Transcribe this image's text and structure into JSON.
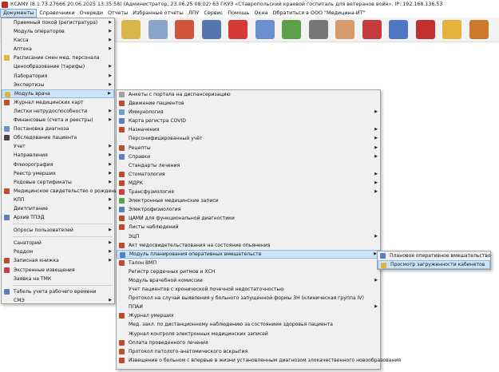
{
  "window": {
    "title": "КСАМУ (8.1.73.27666 20.06.2025 13:35:58) (Администратор, 23.06.25 08:02)  63 ГКУЗ «Ставропольский краевой госпиталь для ветеранов войн». IP: 192.168.136.53"
  },
  "menubar": [
    {
      "label": "Документы"
    },
    {
      "label": "Справочники"
    },
    {
      "label": "Очереди"
    },
    {
      "label": "Отчеты"
    },
    {
      "label": "Избранные отчеты"
    },
    {
      "label": "ЛПУ"
    },
    {
      "label": "Сервис"
    },
    {
      "label": "Помощь"
    },
    {
      "label": "Окна"
    },
    {
      "label": "Обратиться в ООО \"Медицина-ИТ\""
    }
  ],
  "toolbar": [
    {
      "icon": "notepad-icon",
      "color": "#d9b64a"
    },
    {
      "icon": "syringe-icon",
      "color": "#8aa3c9"
    },
    {
      "icon": "pill-bottle-icon",
      "color": "#d1543c"
    },
    {
      "icon": "monitor-chart-icon",
      "color": "#5577b0"
    },
    {
      "icon": "first-aid-icon",
      "color": "#d83a3a"
    },
    {
      "icon": "books-icon",
      "color": "#6b8fcf"
    },
    {
      "icon": "molecules-icon",
      "color": "#5aa14a"
    },
    {
      "icon": "barcode-scanner-icon",
      "color": "#777777"
    },
    {
      "icon": "doctor-icon",
      "color": "#d89b6a"
    },
    {
      "icon": "thermometer-icon",
      "color": "#c23c3c"
    },
    {
      "icon": "patients-icon",
      "color": "#4f77c4"
    },
    {
      "icon": "pdf-icon",
      "color": "#c33030"
    },
    {
      "icon": "lock-icon",
      "color": "#e3b23c"
    },
    {
      "icon": "exit-icon",
      "color": "#cc7a2a"
    }
  ],
  "menu1": [
    {
      "label": "Приемный покой (регистратура)",
      "arrow": true,
      "icon": ""
    },
    {
      "label": "Модуль операторов",
      "arrow": true,
      "icon": ""
    },
    {
      "label": "Касса",
      "arrow": true,
      "icon": ""
    },
    {
      "label": "Аптека",
      "arrow": true,
      "icon": ""
    },
    {
      "label": "Расписание смен мед. персонала",
      "arrow": false,
      "icon": "#e4b53e"
    },
    {
      "label": "Ценообразование (тарифы)",
      "arrow": true,
      "icon": ""
    },
    {
      "label": "Лаборатория",
      "arrow": true,
      "icon": ""
    },
    {
      "label": "Экспертизы",
      "arrow": true,
      "icon": ""
    },
    {
      "label": "Модуль врача",
      "arrow": true,
      "icon": "#d9b64a",
      "highlight": true
    },
    {
      "label": "Журнал медицинских карт",
      "arrow": false,
      "icon": "#c04a2a"
    },
    {
      "label": "Листки нетрудоспособности",
      "arrow": true,
      "icon": ""
    },
    {
      "label": "Финансовые (счета и реестры)",
      "arrow": true,
      "icon": ""
    },
    {
      "label": "Постановка диагноза",
      "arrow": false,
      "icon": "#6c8fc9"
    },
    {
      "label": "Обследование пациента",
      "arrow": false,
      "icon": "#444444"
    },
    {
      "label": "Учет",
      "arrow": true,
      "icon": ""
    },
    {
      "label": "Направления",
      "arrow": true,
      "icon": ""
    },
    {
      "label": "Флюорография",
      "arrow": true,
      "icon": ""
    },
    {
      "label": "Реестр умерших",
      "arrow": true,
      "icon": ""
    },
    {
      "label": "Родовые сертификаты",
      "arrow": true,
      "icon": ""
    },
    {
      "label": "Медицинское свидетельство о рождении",
      "arrow": false,
      "icon": "#c04a2a"
    },
    {
      "label": "КПП",
      "arrow": true,
      "icon": ""
    },
    {
      "label": "Диетпитание",
      "arrow": true,
      "icon": ""
    },
    {
      "label": "Архив ТПЭД",
      "arrow": false,
      "icon": "#5a7fc0"
    },
    {
      "label": "Опросы пользователей",
      "arrow": true,
      "icon": "",
      "sep": true
    },
    {
      "label": "Санаторий",
      "arrow": true,
      "icon": "",
      "sep": true
    },
    {
      "label": "Роддом",
      "arrow": true,
      "icon": ""
    },
    {
      "label": "Записная книжка",
      "arrow": true,
      "icon": "#c04a2a"
    },
    {
      "label": "Экстренные извещения",
      "arrow": false,
      "icon": "#d43a3a"
    },
    {
      "label": "Заявка на ТМК",
      "arrow": false,
      "icon": ""
    },
    {
      "label": "Табель учета рабочего времени",
      "arrow": false,
      "icon": "#5a7fc0",
      "sep": true
    },
    {
      "label": "СМЭ",
      "arrow": true,
      "icon": ""
    }
  ],
  "menu2": [
    {
      "label": "Анкеты с портала на диспансеризацию",
      "arrow": false,
      "icon": "#a0a0a0"
    },
    {
      "label": "Движение пациентов",
      "arrow": false,
      "icon": "#c04a2a"
    },
    {
      "label": "Иммунология",
      "arrow": true,
      "icon": "#6aa0d0"
    },
    {
      "label": "Карта регистра COVID",
      "arrow": false,
      "icon": "#5a7fc0"
    },
    {
      "label": "Назначения",
      "arrow": true,
      "icon": "#c04a2a"
    },
    {
      "label": "Персонифицированный учёт",
      "arrow": true,
      "icon": ""
    },
    {
      "label": "Рецепты",
      "arrow": true,
      "icon": "#c04a2a"
    },
    {
      "label": "Справки",
      "arrow": true,
      "icon": "#5a7fc0"
    },
    {
      "label": "Стандарты лечения",
      "arrow": false,
      "icon": ""
    },
    {
      "label": "Стоматология",
      "arrow": true,
      "icon": "#c04a2a"
    },
    {
      "label": "МДРК",
      "arrow": true,
      "icon": "#c04a2a"
    },
    {
      "label": "Трансфузиология",
      "arrow": true,
      "icon": "#d43a3a"
    },
    {
      "label": "Электронные медицинские записи",
      "arrow": false,
      "icon": "#5aa14a"
    },
    {
      "label": "Электрофизиология",
      "arrow": false,
      "icon": "#5a7fc0"
    },
    {
      "label": "ЦАМИ для функциональной диагностики",
      "arrow": false,
      "icon": "#c04a2a"
    },
    {
      "label": "Листы наблюдений",
      "arrow": false,
      "icon": "#c04a2a"
    },
    {
      "label": "ЭЦП",
      "arrow": true,
      "icon": ""
    },
    {
      "label": "Акт медосвидетельствования на состояние опьянения",
      "arrow": false,
      "icon": "#c04a2a"
    },
    {
      "label": "Модуль планирования оперативных вмешательств",
      "arrow": true,
      "icon": "#5a7fc0",
      "highlight": true
    },
    {
      "label": "Талон ВМП",
      "arrow": false,
      "icon": "#c04a2a"
    },
    {
      "label": "Регистр сердечных ритмов и ХСН",
      "arrow": false,
      "icon": ""
    },
    {
      "label": "Модуль врачебной комиссии",
      "arrow": true,
      "icon": ""
    },
    {
      "label": "Учет пациентов с хронической почечной недостаточностью",
      "arrow": false,
      "icon": ""
    },
    {
      "label": "Протокол на случай выявления у больного запущенной формы ЗН (клиническая группа IV)",
      "arrow": false,
      "icon": ""
    },
    {
      "label": "ППАИ",
      "arrow": true,
      "icon": ""
    },
    {
      "label": "Журнал умерших",
      "arrow": false,
      "icon": "#c04a2a"
    },
    {
      "label": "Мед. закл. по дистанционному наблюдению за состоянием здоровья пациента",
      "arrow": false,
      "icon": ""
    },
    {
      "label": "Журнал контроля электронных медицинских записей",
      "arrow": false,
      "icon": ""
    },
    {
      "label": "Оплата проведенного лечения",
      "arrow": false,
      "icon": "#c04a2a"
    },
    {
      "label": "Протокол патолого-анатомического вскрытия",
      "arrow": false,
      "icon": "#c04a2a"
    },
    {
      "label": "Извещение о больном с впервые в жизни установленным диагнозом злокачественного новообразования",
      "arrow": false,
      "icon": "#c04a2a"
    }
  ],
  "menu3": [
    {
      "label": "Плановое оперативное вмешательство",
      "icon": "#5a7fc0"
    },
    {
      "label": "Просмотр загруженности кабинетов",
      "icon": "#e4b53e",
      "highlight": true
    }
  ]
}
